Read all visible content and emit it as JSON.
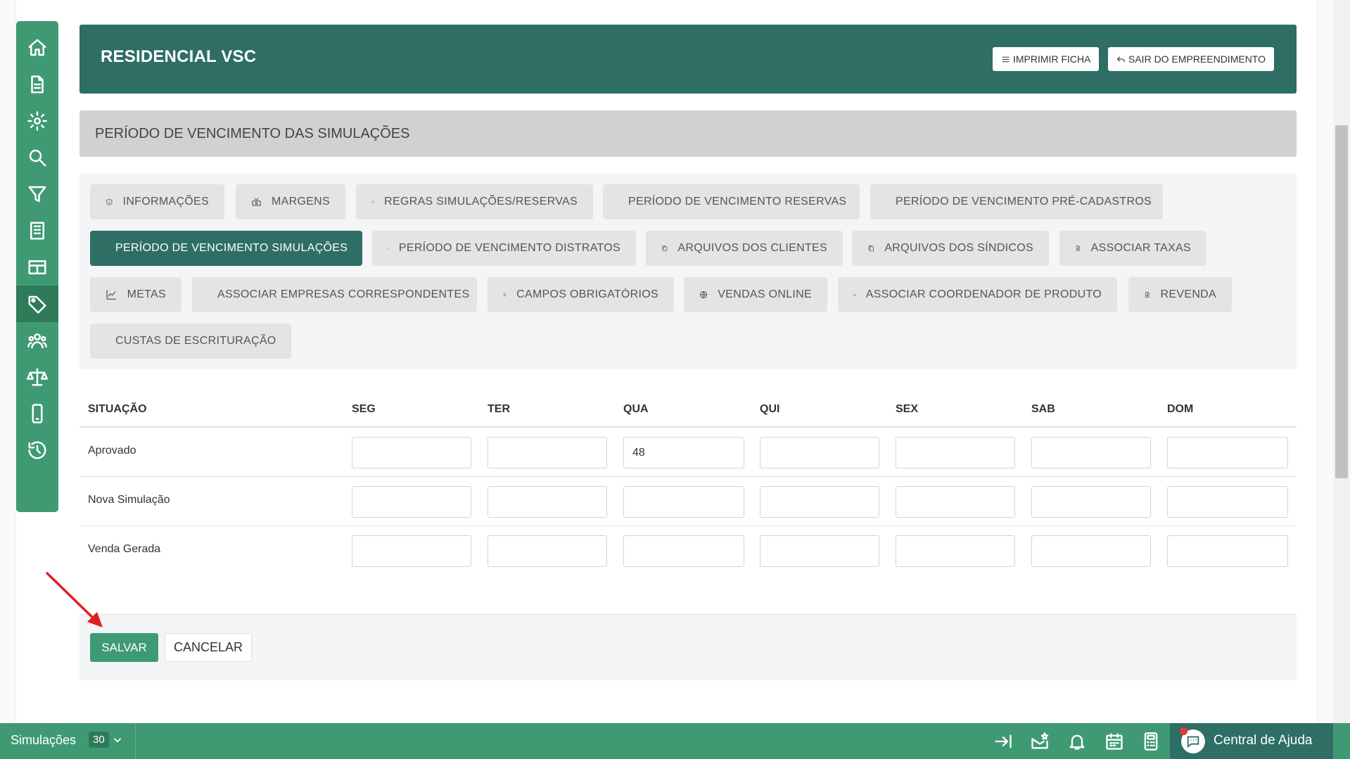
{
  "header": {
    "title": "RESIDENCIAL VSC",
    "print_label": "IMPRIMIR FICHA",
    "exit_label": "SAIR DO EMPREENDIMENTO"
  },
  "section": {
    "title": "PERÍODO DE VENCIMENTO DAS SIMULAÇÕES"
  },
  "tabs": [
    {
      "label": "INFORMAÇÕES",
      "icon": "info-icon"
    },
    {
      "label": "MARGENS",
      "icon": "margins-icon"
    },
    {
      "label": "REGRAS SIMULAÇÕES/RESERVAS",
      "icon": "refresh-icon"
    },
    {
      "label": "PERÍODO DE VENCIMENTO RESERVAS",
      "icon": "calendar-icon"
    },
    {
      "label": "PERÍODO DE VENCIMENTO PRÉ-CADASTROS",
      "icon": "calendar-icon"
    },
    {
      "label": "PERÍODO DE VENCIMENTO SIMULAÇÕES",
      "icon": "calendar-icon",
      "active": true
    },
    {
      "label": "PERÍODO DE VENCIMENTO DISTRATOS",
      "icon": "calendar-icon"
    },
    {
      "label": "ARQUIVOS DOS CLIENTES",
      "icon": "copy-icon"
    },
    {
      "label": "ARQUIVOS DOS SÍNDICOS",
      "icon": "copy-icon"
    },
    {
      "label": "ASSOCIAR TAXAS",
      "icon": "invoice-icon"
    },
    {
      "label": "METAS",
      "icon": "chart-line-icon"
    },
    {
      "label": "ASSOCIAR EMPRESAS CORRESPONDENTES",
      "icon": "user-icon"
    },
    {
      "label": "CAMPOS OBRIGATÓRIOS",
      "icon": "file-check-icon"
    },
    {
      "label": "VENDAS ONLINE",
      "icon": "globe-icon"
    },
    {
      "label": "ASSOCIAR COORDENADOR DE PRODUTO",
      "icon": "team-icon"
    },
    {
      "label": "REVENDA",
      "icon": "invoice-icon"
    },
    {
      "label": "CUSTAS DE ESCRITURAÇÃO",
      "icon": "invoice-icon"
    }
  ],
  "table": {
    "headers": [
      "SITUAÇÃO",
      "SEG",
      "TER",
      "QUA",
      "QUI",
      "SEX",
      "SAB",
      "DOM"
    ],
    "rows": [
      {
        "label": "Aprovado",
        "values": [
          "",
          "",
          "48",
          "",
          "",
          "",
          ""
        ]
      },
      {
        "label": "Nova Simulação",
        "values": [
          "",
          "",
          "",
          "",
          "",
          "",
          ""
        ]
      },
      {
        "label": "Venda Gerada",
        "values": [
          "",
          "",
          "",
          "",
          "",
          "",
          ""
        ]
      }
    ]
  },
  "actions": {
    "save_label": "SALVAR",
    "cancel_label": "CANCELAR"
  },
  "bottom_bar": {
    "simulations_label": "Simulações",
    "simulations_count": "30",
    "help_label": "Central de Ajuda"
  },
  "colors": {
    "sidebar": "#3f9a73",
    "header": "#2e6e64",
    "active_tab": "#2e6e64",
    "save_button": "#3f9a73",
    "notification_dot": "#e53935",
    "annotation_arrow": "#e02020"
  },
  "sidebar_icons": [
    "home-icon",
    "document-icon",
    "gear-icon",
    "search-icon",
    "filter-icon",
    "building-icon",
    "table-icon",
    "tag-icon",
    "users-icon",
    "scale-icon",
    "mobile-icon",
    "history-icon"
  ]
}
